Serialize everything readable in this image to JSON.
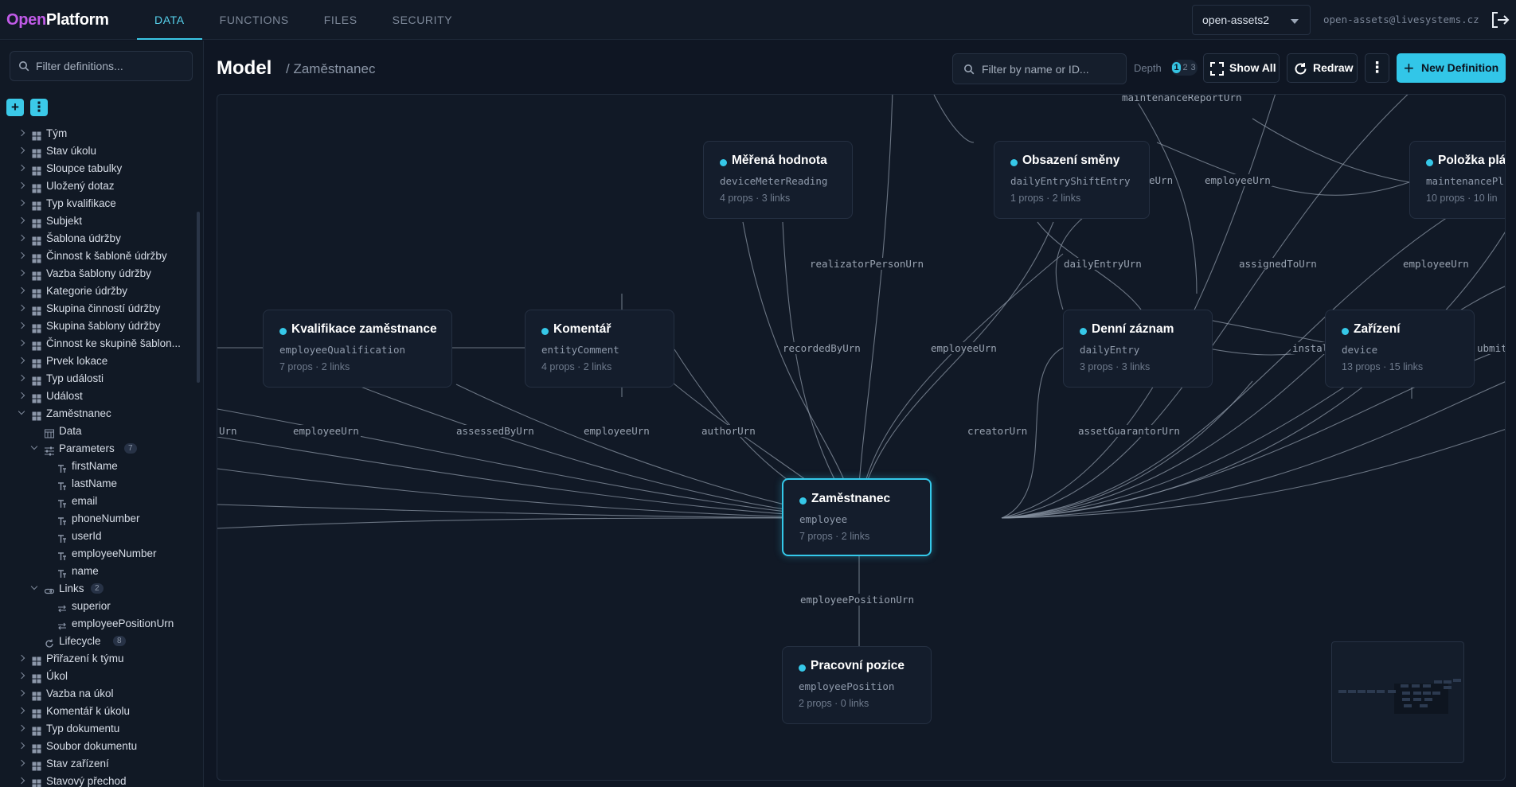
{
  "app": {
    "logo_open": "Open",
    "logo_platform": "Platform"
  },
  "nav": {
    "tabs": [
      "DATA",
      "FUNCTIONS",
      "FILES",
      "SECURITY"
    ],
    "active": "DATA"
  },
  "workspace": {
    "selected": "open-assets2"
  },
  "user": {
    "email": "open-assets@livesystems.cz"
  },
  "sidebar": {
    "search_placeholder": "Filter definitions...",
    "items": [
      "Tým",
      "Stav úkolu",
      "Sloupce tabulky",
      "Uložený dotaz",
      "Typ kvalifikace",
      "Subjekt",
      "Šablona údržby",
      "Činnost k šabloně údržby",
      "Vazba šablony údržby",
      "Kategorie údržby",
      "Skupina činností údržby",
      "Skupina šablony údržby",
      "Činnost ke skupině šablon...",
      "Prvek lokace",
      "Typ události",
      "Událost",
      "Zaměstnanec"
    ],
    "expanded": {
      "data_label": "Data",
      "parameters_label": "Parameters",
      "parameters_count": "7",
      "parameters": [
        "firstName",
        "lastName",
        "email",
        "phoneNumber",
        "userId",
        "employeeNumber",
        "name"
      ],
      "links_label": "Links",
      "links_count": "2",
      "links": [
        "superior",
        "employeePositionUrn"
      ],
      "lifecycle_label": "Lifecycle",
      "lifecycle_count": "8"
    },
    "items_after": [
      "Přiřazení k týmu",
      "Úkol",
      "Vazba na úkol",
      "Komentář k úkolu",
      "Typ dokumentu",
      "Soubor dokumentu",
      "Stav zařízení",
      "Stavový přechod"
    ]
  },
  "header": {
    "title": "Model",
    "breadcrumb": "/ Zaměstnanec",
    "filter_placeholder": "Filter by name or ID...",
    "depth_label": "Depth",
    "depth_options": [
      "1",
      "2",
      "3"
    ],
    "depth_selected": "1",
    "show_all": "Show All",
    "redraw": "Redraw",
    "new_definition": "New Definition"
  },
  "graph": {
    "nodes": [
      {
        "name": "Měřená hodnota",
        "id": "deviceMeterReading",
        "meta": "4 props · 3 links"
      },
      {
        "name": "Obsazení směny",
        "id": "dailyEntryShiftEntry",
        "meta": "1 props · 2 links"
      },
      {
        "name": "Položka plá",
        "id": "maintenancePl",
        "meta": "10 props · 10 lin"
      },
      {
        "name": "Kvalifikace zaměstnance",
        "id": "employeeQualification",
        "meta": "7 props · 2 links"
      },
      {
        "name": "Komentář",
        "id": "entityComment",
        "meta": "4 props · 2 links"
      },
      {
        "name": "Denní záznam",
        "id": "dailyEntry",
        "meta": "3 props · 3 links"
      },
      {
        "name": "Zařízení",
        "id": "device",
        "meta": "13 props · 15 links"
      },
      {
        "name": "Zaměstnanec",
        "id": "employee",
        "meta": "7 props · 2 links"
      },
      {
        "name": "Pracovní pozice",
        "id": "employeePosition",
        "meta": "2 props · 0 links"
      }
    ],
    "edge_labels": [
      "maintenanceReportUrn",
      "eUrn",
      "employeeUrn",
      "realizatorPersonUrn",
      "dailyEntryUrn",
      "assignedToUrn",
      "employeeUrn",
      "recordedByUrn",
      "employeeUrn",
      "instal",
      "ubmit",
      "Urn",
      "employeeUrn",
      "assessedByUrn",
      "employeeUrn",
      "authorUrn",
      "creatorUrn",
      "assetGuarantorUrn",
      "employeePositionUrn"
    ]
  },
  "colors": {
    "accent": "#34c9ea",
    "brand": "#c15be8",
    "background": "#0f1623"
  }
}
